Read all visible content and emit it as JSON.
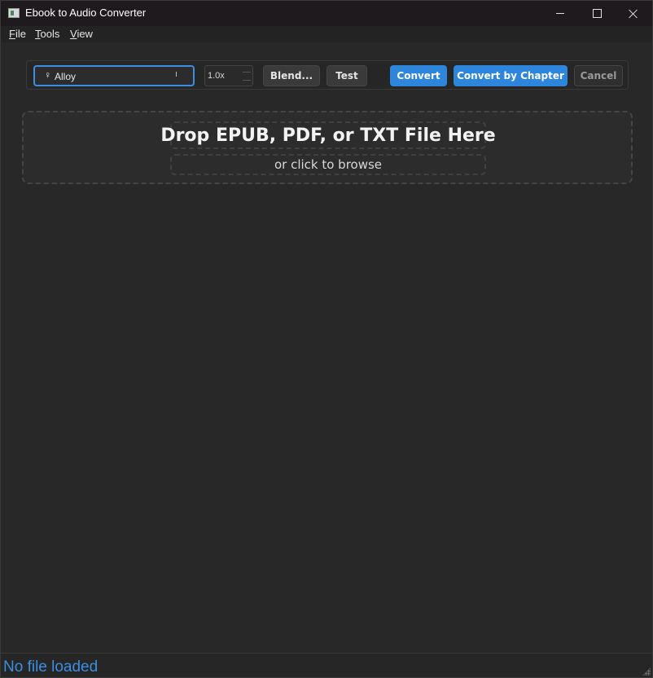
{
  "window": {
    "title": "Ebook to Audio Converter",
    "icon": "book-icon"
  },
  "menu": {
    "file": {
      "accel": "F",
      "rest": "ile"
    },
    "tools": {
      "accel": "T",
      "rest": "ools"
    },
    "view": {
      "accel": "V",
      "rest": "iew"
    }
  },
  "toolbar": {
    "voice": {
      "gender_symbol": "♀",
      "value": "Alloy"
    },
    "speed": {
      "value": "1.0x"
    },
    "blend_label": "Blend...",
    "test_label": "Test",
    "convert_label": "Convert",
    "convert_chapter_label": "Convert by Chapter",
    "cancel_label": "Cancel"
  },
  "dropzone": {
    "title": "Drop EPUB, PDF, or TXT File Here",
    "subtitle": "or click to browse"
  },
  "status": {
    "text": "No file loaded"
  },
  "colors": {
    "accent": "#2d86dc",
    "background": "#282828",
    "titlebar": "#1f1a1e"
  }
}
